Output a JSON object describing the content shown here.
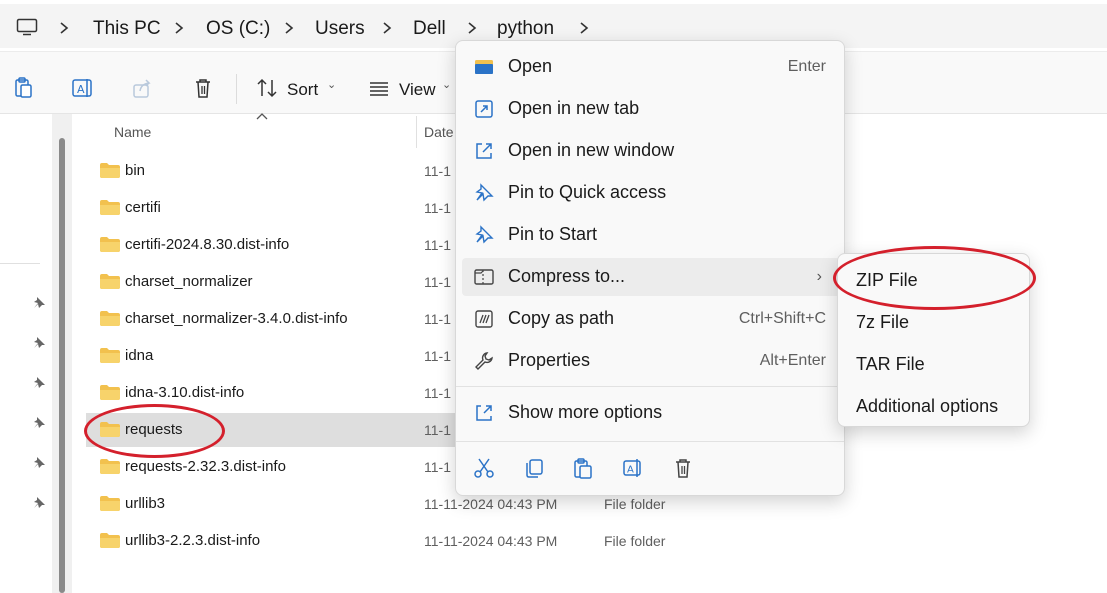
{
  "breadcrumb": [
    "This PC",
    "OS (C:)",
    "Users",
    "Dell",
    "python"
  ],
  "toolbar": {
    "sort_label": "Sort",
    "view_label": "View"
  },
  "columns": {
    "name": "Name",
    "date": "Date"
  },
  "files": [
    {
      "name": "bin",
      "date": "11-1",
      "type": ""
    },
    {
      "name": "certifi",
      "date": "11-1",
      "type": ""
    },
    {
      "name": "certifi-2024.8.30.dist-info",
      "date": "11-1",
      "type": ""
    },
    {
      "name": "charset_normalizer",
      "date": "11-1",
      "type": ""
    },
    {
      "name": "charset_normalizer-3.4.0.dist-info",
      "date": "11-1",
      "type": ""
    },
    {
      "name": "idna",
      "date": "11-1",
      "type": ""
    },
    {
      "name": "idna-3.10.dist-info",
      "date": "11-1",
      "type": ""
    },
    {
      "name": "requests",
      "date": "11-1",
      "type": ""
    },
    {
      "name": "requests-2.32.3.dist-info",
      "date": "11-1",
      "type": ""
    },
    {
      "name": "urllib3",
      "date": "11-11-2024 04:43 PM",
      "type": "File folder"
    },
    {
      "name": "urllib3-2.2.3.dist-info",
      "date": "11-11-2024 04:43 PM",
      "type": "File folder"
    }
  ],
  "context_menu": {
    "items": [
      {
        "label": "Open",
        "accel": "Enter",
        "icon": "folder-open-icon"
      },
      {
        "label": "Open in new tab",
        "accel": "",
        "icon": "new-tab-icon"
      },
      {
        "label": "Open in new window",
        "accel": "",
        "icon": "new-window-icon"
      },
      {
        "label": "Pin to Quick access",
        "accel": "",
        "icon": "pin-icon"
      },
      {
        "label": "Pin to Start",
        "accel": "",
        "icon": "pin-icon"
      },
      {
        "label": "Compress to...",
        "accel": "",
        "icon": "zip-folder-icon"
      },
      {
        "label": "Copy as path",
        "accel": "Ctrl+Shift+C",
        "icon": "copy-path-icon"
      },
      {
        "label": "Properties",
        "accel": "Alt+Enter",
        "icon": "wrench-icon"
      }
    ],
    "more": {
      "label": "Show more options",
      "icon": "show-more-icon"
    },
    "quick_actions": [
      "cut-icon",
      "copy-icon",
      "paste-icon",
      "rename-icon",
      "delete-icon"
    ]
  },
  "submenu": [
    "ZIP File",
    "7z File",
    "TAR File",
    "Additional options"
  ],
  "colors": {
    "annotation": "#d4202c",
    "folder": "#f2c14e",
    "icon_blue": "#2b73c7"
  }
}
